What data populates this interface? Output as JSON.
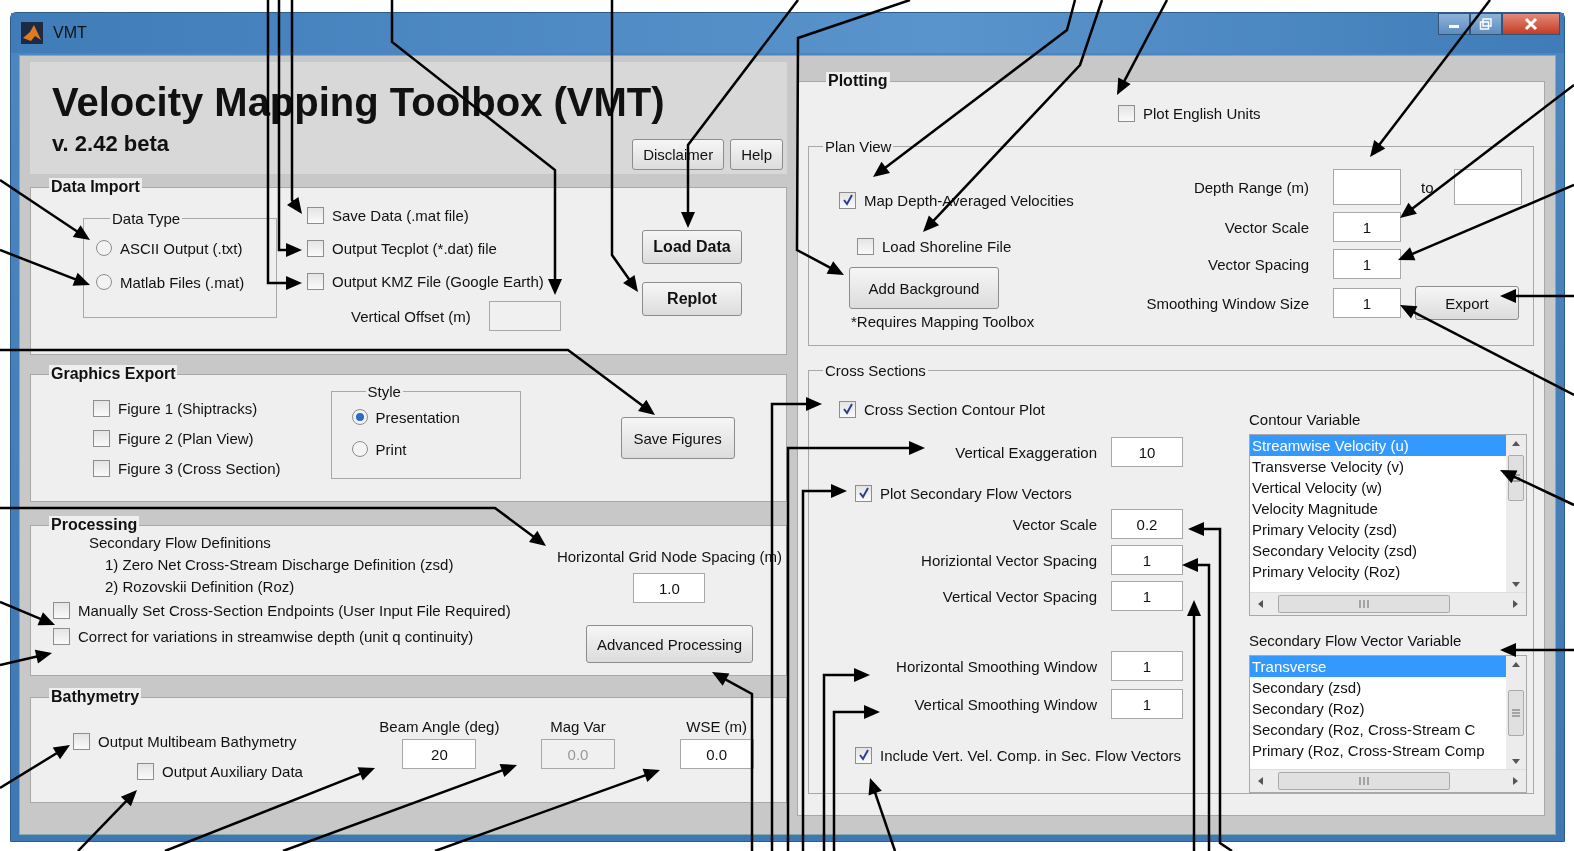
{
  "window": {
    "title": "VMT"
  },
  "header": {
    "title": "Velocity Mapping Toolbox (VMT)",
    "version": "v. 2.42 beta",
    "buttons": [
      "Disclaimer",
      "Help"
    ]
  },
  "data_import": {
    "title": "Data Import",
    "data_type": {
      "title": "Data Type",
      "options": [
        {
          "label": "ASCII Output (.txt)",
          "selected": false
        },
        {
          "label": "Matlab Files (.mat)",
          "selected": false
        }
      ]
    },
    "options": [
      {
        "label": "Save Data (.mat file)",
        "checked": false
      },
      {
        "label": "Output Tecplot (*.dat) file",
        "checked": false
      },
      {
        "label": "Output KMZ File (Google Earth)",
        "checked": false
      }
    ],
    "vertical_offset_label": "Vertical Offset (m)",
    "buttons": [
      "Load Data",
      "Replot"
    ]
  },
  "graphics_export": {
    "title": "Graphics Export",
    "figures": [
      {
        "label": "Figure 1 (Shiptracks)",
        "checked": false
      },
      {
        "label": "Figure 2 (Plan View)",
        "checked": false
      },
      {
        "label": "Figure 3 (Cross Section)",
        "checked": false
      }
    ],
    "style": {
      "title": "Style",
      "options": [
        {
          "label": "Presentation",
          "selected": true
        },
        {
          "label": "Print",
          "selected": false
        }
      ]
    },
    "button": "Save Figures"
  },
  "processing": {
    "title": "Processing",
    "definitions_title": "Secondary Flow Definitions",
    "definitions": [
      "1) Zero Net Cross-Stream Discharge Definition (zsd)",
      "2) Rozovskii Definition (Roz)"
    ],
    "grid_spacing": {
      "label": "Horizontal Grid Node Spacing (m)",
      "value": "1.0"
    },
    "options": [
      {
        "label": "Manually Set Cross-Section Endpoints (User Input File Required)",
        "checked": false
      },
      {
        "label": "Correct for variations in streamwise depth (unit q continuity)",
        "checked": false
      }
    ],
    "button": "Advanced Processing"
  },
  "bathymetry": {
    "title": "Bathymetry",
    "options": [
      {
        "label": "Output Multibeam Bathymetry",
        "checked": false
      },
      {
        "label": "Output Auxiliary Data",
        "checked": false
      }
    ],
    "fields": [
      {
        "label": "Beam Angle (deg)",
        "value": "20",
        "disabled": false
      },
      {
        "label": "Mag Var",
        "value": "0.0",
        "disabled": true
      },
      {
        "label": "WSE (m)",
        "value": "0.0",
        "disabled": false
      }
    ]
  },
  "plotting": {
    "title": "Plotting",
    "english_units": {
      "label": "Plot English Units",
      "checked": false
    },
    "plan_view": {
      "title": "Plan View",
      "options": [
        {
          "label": "Map Depth-Averaged Velocities",
          "checked": true
        },
        {
          "label": "Load Shoreline File",
          "checked": false
        }
      ],
      "background_button": "Add Background",
      "note": "*Requires Mapping Toolbox",
      "depth_range": {
        "label": "Depth Range (m)",
        "to": "to"
      },
      "fields": [
        {
          "label": "Vector Scale",
          "value": "1"
        },
        {
          "label": "Vector Spacing",
          "value": "1"
        },
        {
          "label": "Smoothing Window Size",
          "value": "1"
        }
      ],
      "export_button": "Export"
    },
    "cross_sections": {
      "title": "Cross Sections",
      "contour_plot": {
        "label": "Cross Section Contour Plot",
        "checked": true
      },
      "vertical_exaggeration": {
        "label": "Vertical Exaggeration",
        "value": "10"
      },
      "secondary_vectors": {
        "label": "Plot Secondary Flow Vectors",
        "checked": true
      },
      "vector_fields": [
        {
          "label": "Vector Scale",
          "value": "0.2"
        },
        {
          "label": "Horiziontal Vector Spacing",
          "value": "1"
        },
        {
          "label": "Vertical Vector Spacing",
          "value": "1"
        }
      ],
      "smoothing_fields": [
        {
          "label": "Horizontal Smoothing Window",
          "value": "1"
        },
        {
          "label": "Vertical Smoothing Window",
          "value": "1"
        }
      ],
      "include_vertical": {
        "label": "Include Vert. Vel. Comp. in Sec. Flow Vectors",
        "checked": true
      },
      "contour_variable": {
        "title": "Contour Variable",
        "items": [
          {
            "label": "Streamwise Velocity (u)",
            "selected": true
          },
          {
            "label": "Transverse Velocity (v)",
            "selected": false
          },
          {
            "label": "Vertical Velocity (w)",
            "selected": false
          },
          {
            "label": "Velocity Magnitude",
            "selected": false
          },
          {
            "label": "Primary Velocity (zsd)",
            "selected": false
          },
          {
            "label": "Secondary Velocity (zsd)",
            "selected": false
          },
          {
            "label": "Primary Velocity (Roz)",
            "selected": false
          }
        ]
      },
      "secondary_variable": {
        "title": "Secondary Flow Vector Variable",
        "items": [
          {
            "label": "Transverse",
            "selected": true
          },
          {
            "label": "Secondary (zsd)",
            "selected": false
          },
          {
            "label": "Secondary (Roz)",
            "selected": false
          },
          {
            "label": "Secondary (Roz, Cross-Stream C",
            "selected": false
          },
          {
            "label": "Primary (Roz, Cross-Stream Comp",
            "selected": false
          }
        ]
      }
    }
  }
}
